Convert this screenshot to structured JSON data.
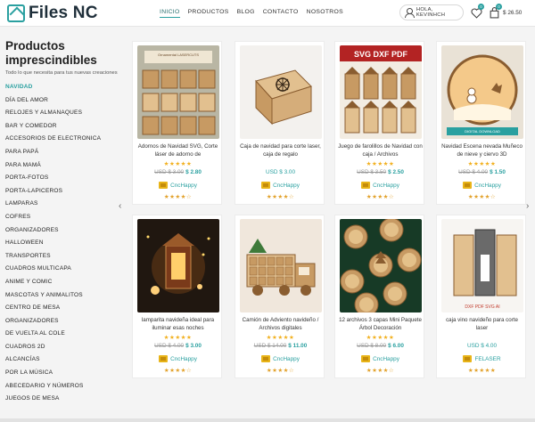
{
  "header": {
    "logo_text": "Files NC",
    "nav": [
      "INICIO",
      "PRODUCTOS",
      "BLOG",
      "CONTACTO",
      "NOSOTROS"
    ],
    "account_label": "HOLA, KEVINHCH",
    "wishlist_count": "0",
    "cart_count": "0",
    "cart_total": "$ 26.50",
    "accent_color": "#2aa0a0"
  },
  "sidebar": {
    "title": "Productos imprescindibles",
    "subtitle": "Todo lo que necesita para tus nuevas creaciones",
    "categories": [
      "NAVIDAD",
      "DÍA DEL AMOR",
      "RELOJES Y ALMANAQUES",
      "BAR Y COMEDOR",
      "ACCESORIOS DE ELECTRONICA",
      "PARA PAPÁ",
      "PARA MAMÁ",
      "PORTA-FOTOS",
      "PORTA-LAPICEROS",
      "LAMPARAS",
      "COFRES",
      "ORGANIZADORES",
      "HALLOWEEN",
      "TRANSPORTES",
      "CUADROS MULTICAPA",
      "ANIME Y COMIC",
      "MASCOTAS Y ANIMALITOS",
      "CENTRO DE MESA",
      "ORGANIZADORES",
      "DE VUELTA AL COLE",
      "CUADROS 2D",
      "ALCANCÍAS",
      "POR LA MÚSICA",
      "ABECEDARIO Y NÚMEROS",
      "JUEGOS DE MESA"
    ]
  },
  "products": [
    {
      "title": "Adornos de Navidad SVG, Corte láser de adorno de",
      "stars": "★★★★★",
      "old_price": "USD $ 3.00",
      "price": "$ 2.80",
      "vendor": "CncHappy",
      "vendor_stars": "★★★★☆",
      "image": "ornament-boxes",
      "thumb_caption": "Ornamental LASERCUTS"
    },
    {
      "title": "Caja de navidad para corte laser, caja de regalo",
      "stars": "",
      "old_price": "",
      "price": "USD $ 3.00",
      "vendor": "CncHappy",
      "vendor_stars": "★★★★☆",
      "image": "snowflake-box",
      "thumb_caption": ""
    },
    {
      "title": "Juego de farolillos de Navidad con caja / Archivos",
      "stars": "★★★★★",
      "old_price": "USD $ 3.50",
      "price": "$ 2.50",
      "vendor": "CncHappy",
      "vendor_stars": "★★★★☆",
      "image": "lantern-set",
      "thumb_caption": "SVG DXF PDF"
    },
    {
      "title": "Navidad Escena nevada Muñeco de nieve y ciervo 3D",
      "stars": "★★★★★",
      "old_price": "USD $ 4.00",
      "price": "$ 1.50",
      "vendor": "CncHappy",
      "vendor_stars": "★★★★☆",
      "image": "snow-scene",
      "thumb_caption": "DIGITAL DOWNLOAD"
    },
    {
      "title": "lamparita navideña ideal para iluminar esas noches",
      "stars": "★★★★★",
      "old_price": "USD $ 4.00",
      "price": "$ 3.00",
      "vendor": "CncHappy",
      "vendor_stars": "★★★★☆",
      "image": "lantern-lamp",
      "thumb_caption": ""
    },
    {
      "title": "Camión de Adviento navideño / Archivos digitales",
      "stars": "★★★★★",
      "old_price": "USD $ 14.00",
      "price": "$ 11.00",
      "vendor": "CncHappy",
      "vendor_stars": "★★★★☆",
      "image": "advent-truck",
      "thumb_caption": ""
    },
    {
      "title": "12 archivos 3 capas Mini Paquete Árbol Decoración",
      "stars": "★★★★★",
      "old_price": "USD $ 8.00",
      "price": "$ 6.00",
      "vendor": "CncHappy",
      "vendor_stars": "★★★★☆",
      "image": "tree-ornaments",
      "thumb_caption": ""
    },
    {
      "title": "caja vino navideño para corte laser",
      "stars": "",
      "old_price": "",
      "price": "USD $ 4.00",
      "vendor": "FELASER",
      "vendor_stars": "★★★★★",
      "image": "wine-box",
      "thumb_caption": "DXF PDF SVG AI"
    }
  ]
}
